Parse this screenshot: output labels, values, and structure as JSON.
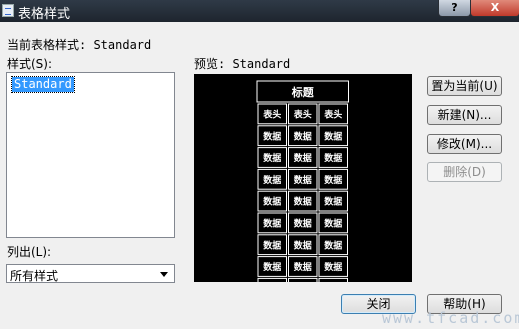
{
  "window": {
    "title": "表格样式",
    "help_glyph": "?",
    "close_glyph": "X"
  },
  "current_style": {
    "label": "当前表格样式: Standard"
  },
  "styles": {
    "label": "样式(S):",
    "items": [
      "Standard"
    ]
  },
  "list_filter": {
    "label": "列出(L):",
    "value": "所有样式"
  },
  "preview": {
    "label": "预览: Standard",
    "table_title": "标题",
    "header_cell": "表头",
    "data_cell": "数据",
    "data_rows": 8,
    "columns": 3
  },
  "buttons": {
    "set_current": "置为当前(U)",
    "new": "新建(N)...",
    "modify": "修改(M)...",
    "delete": "删除(D)",
    "close": "关闭",
    "help": "帮助(H)"
  },
  "watermark": "www.tfcad.com"
}
